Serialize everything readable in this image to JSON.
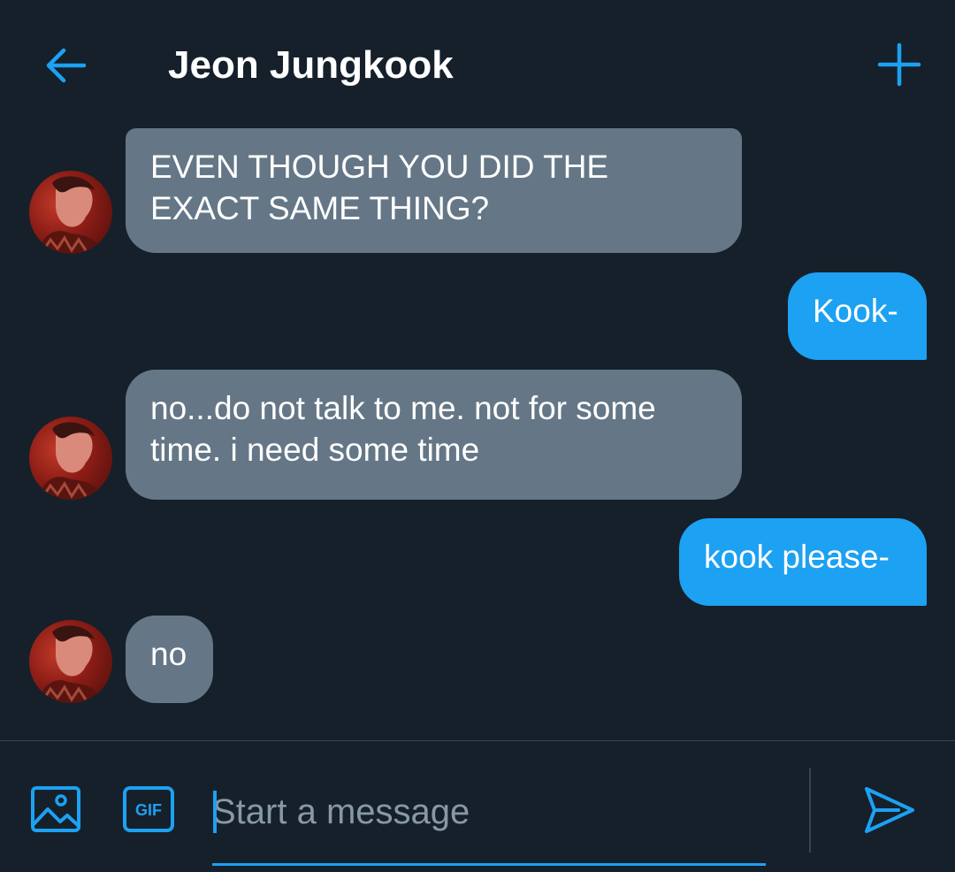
{
  "header": {
    "title": "Jeon Jungkook",
    "back_icon": "arrow-left-icon",
    "add_icon": "plus-icon"
  },
  "colors": {
    "background": "#15202b",
    "accent": "#1da1f2",
    "incoming_bubble": "#657786",
    "divider": "#38444d",
    "placeholder": "#8899a6"
  },
  "messages": [
    {
      "direction": "incoming",
      "text": "EVEN THOUGH YOU DID THE EXACT SAME THING?"
    },
    {
      "direction": "outgoing",
      "text": "Kook-"
    },
    {
      "direction": "incoming",
      "text": "no...do not talk to me. not for some time. i need some time"
    },
    {
      "direction": "outgoing",
      "text": "kook please-"
    },
    {
      "direction": "incoming",
      "text": "no"
    }
  ],
  "composer": {
    "placeholder": "Start a message",
    "image_icon": "image-icon",
    "gif_label": "GIF",
    "send_icon": "send-icon"
  }
}
